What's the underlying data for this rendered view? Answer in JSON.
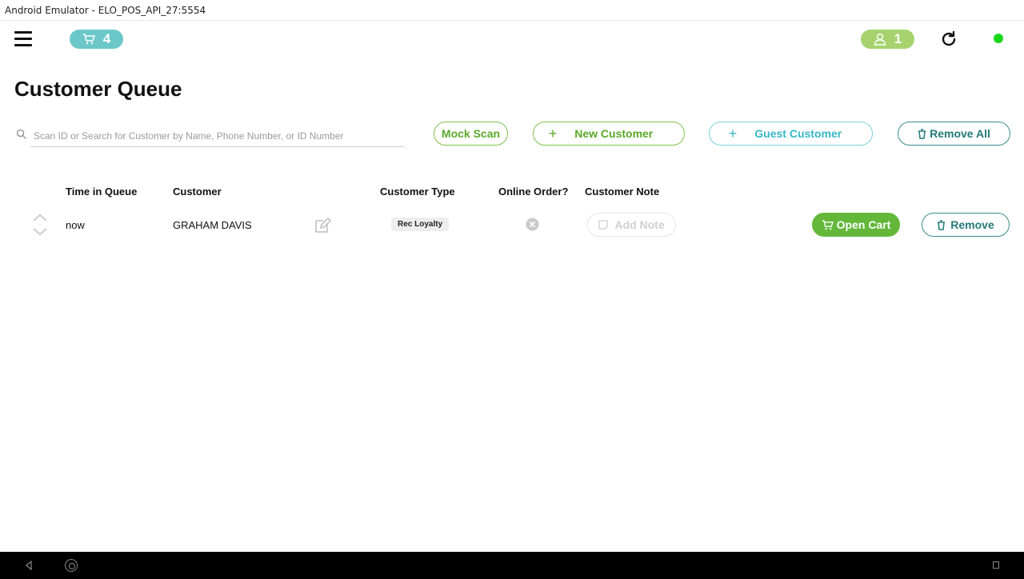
{
  "window": {
    "title": "Android Emulator - ELO_POS_API_27:5554"
  },
  "topbar": {
    "cart_count": "4",
    "user_count": "1",
    "status_color": "#19d619",
    "icons": [
      "menu-icon",
      "cart-icon",
      "user-icon",
      "refresh-icon",
      "status-dot"
    ]
  },
  "page": {
    "title": "Customer Queue"
  },
  "search": {
    "placeholder": "Scan ID or Search for Customer by Name, Phone Number, or ID Number",
    "value": ""
  },
  "actions": {
    "mock_scan": "Mock Scan",
    "new_customer": "New Customer",
    "guest_customer": "Guest Customer",
    "remove_all": "Remove All",
    "plus_symbol": "+"
  },
  "table": {
    "headers": {
      "time_in_queue": "Time in Queue",
      "customer": "Customer",
      "customer_type": "Customer Type",
      "online_order": "Online Order?",
      "customer_note": "Customer Note"
    },
    "rows": [
      {
        "time": "now",
        "customer": "GRAHAM DAVIS",
        "customer_type": "Rec Loyalty",
        "online_order": false,
        "add_note_label": "Add Note",
        "open_cart_label": "Open Cart",
        "remove_label": "Remove"
      }
    ]
  },
  "colors": {
    "cart_pill": "#6cc8c8",
    "user_pill": "#a6d36e",
    "green": "#63b83a",
    "teal": "#237979",
    "cyan": "#36b8c6"
  }
}
